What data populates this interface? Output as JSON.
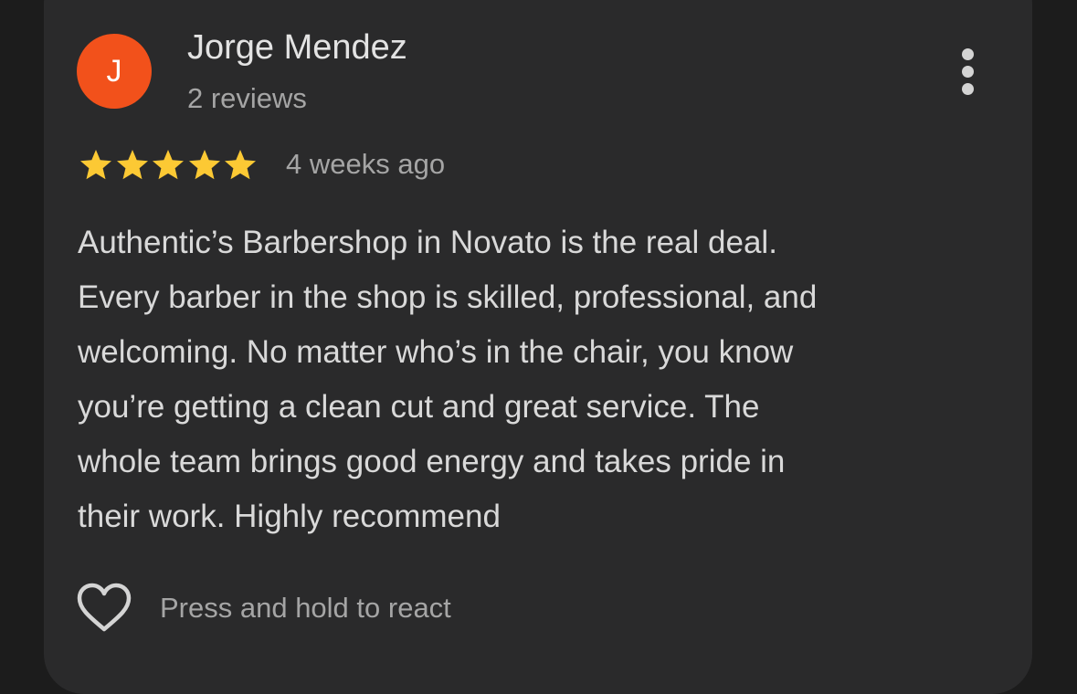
{
  "review": {
    "author": {
      "initial": "J",
      "name": "Jorge Mendez",
      "review_count": "2 reviews",
      "avatar_color": "#f2511b"
    },
    "rating": 5,
    "rating_max": 5,
    "time_ago": "4 weeks ago",
    "star_color": "#fcc934",
    "text_lines": [
      "Authentic’s Barbershop in Novato is the real deal.",
      "Every barber in the shop is skilled, professional, and",
      "welcoming. No matter who’s in the chair, you know",
      "you’re getting a clean cut and great service. The",
      "whole team brings good energy and takes pride in",
      "their work. Highly recommend"
    ],
    "react_hint": "Press and hold to react"
  },
  "icons": {
    "more": "more-vertical-icon",
    "star": "star-icon",
    "react": "heart-icon"
  }
}
